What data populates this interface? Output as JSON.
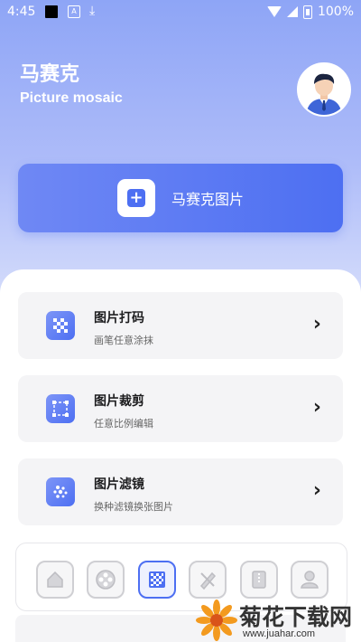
{
  "status_bar": {
    "time": "4:45",
    "battery": "100%"
  },
  "header": {
    "title": "马赛克",
    "subtitle": "Picture mosaic"
  },
  "primary_action": {
    "label": "马赛克图片",
    "icon": "plus-icon"
  },
  "features": [
    {
      "title": "图片打码",
      "subtitle": "画笔任意涂抹",
      "icon": "mosaic-icon"
    },
    {
      "title": "图片裁剪",
      "subtitle": "任意比例编辑",
      "icon": "crop-icon"
    },
    {
      "title": "图片滤镜",
      "subtitle": "换种滤镜换张图片",
      "icon": "filter-icon"
    }
  ],
  "tabs": [
    {
      "icon": "home-icon",
      "active": false
    },
    {
      "icon": "film-reel-icon",
      "active": false
    },
    {
      "icon": "mosaic-icon",
      "active": true
    },
    {
      "icon": "tools-icon",
      "active": false
    },
    {
      "icon": "archive-icon",
      "active": false
    },
    {
      "icon": "user-icon",
      "active": false
    }
  ],
  "watermark": {
    "text": "菊花下载网",
    "url": "www.juahar.com"
  },
  "colors": {
    "accent": "#4d6ff2",
    "hero_top": "#8ea5f6"
  }
}
